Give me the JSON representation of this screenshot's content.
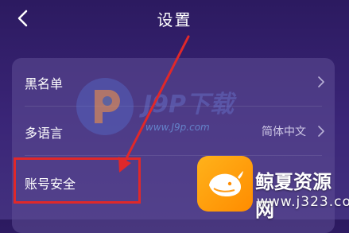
{
  "header": {
    "title": "设置"
  },
  "settings": {
    "items": [
      {
        "label": "黑名单",
        "value": ""
      },
      {
        "label": "多语言",
        "value": "简体中文"
      },
      {
        "label": "账号安全",
        "value": ""
      }
    ]
  },
  "watermark": {
    "text": "J9P下载",
    "url": "www.J9p.com"
  },
  "brand": {
    "name": "鲸夏资源网",
    "url": "www.j323.com"
  },
  "colors": {
    "background": "#2c1a60",
    "card": "#5f4e96",
    "annotation": "#e0282a",
    "logo": "#ffa500"
  }
}
